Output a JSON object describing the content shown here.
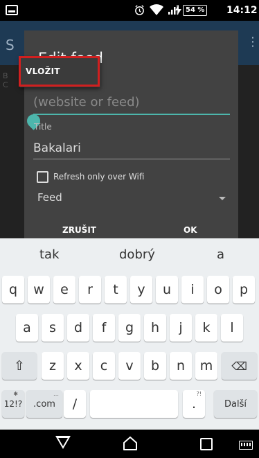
{
  "status_bar": {
    "battery": "54 %",
    "time": "14:12",
    "icons": [
      "image-icon",
      "alarm-icon",
      "wifi-icon",
      "signal-icon",
      "charging-icon"
    ]
  },
  "background_app": {
    "title_fragment": "S",
    "menu_fragment": "⋮",
    "text_fragment": "B\nC"
  },
  "dialog": {
    "title": "Edit feed",
    "url_placeholder": "(website or feed)",
    "title_label": "Title",
    "title_value": "Bakalari",
    "wifi_label": "Refresh only over Wifi",
    "type_value": "Feed",
    "cancel_label": "ZRUŠIT",
    "ok_label": "OK"
  },
  "paste_popup": {
    "label": "VLOŽIT"
  },
  "keyboard": {
    "suggestions": [
      "tak",
      "dobrý",
      "a"
    ],
    "row1": [
      "q",
      "w",
      "e",
      "r",
      "t",
      "y",
      "u",
      "i",
      "o",
      "p"
    ],
    "row2": [
      "a",
      "s",
      "d",
      "f",
      "g",
      "h",
      "j",
      "k",
      "l"
    ],
    "row3": [
      "z",
      "x",
      "c",
      "v",
      "b",
      "n",
      "m"
    ],
    "shift": "⇧",
    "backspace": "⌫",
    "symbols": "12!?",
    "dotcom": ".com",
    "dotcom_hint": "…",
    "slash": "/",
    "period": ".",
    "period_hint": "?!",
    "enter": "Další"
  },
  "colors": {
    "accent": "#4db6ac",
    "highlight": "#d11f1f",
    "dialog_bg": "#424242"
  }
}
